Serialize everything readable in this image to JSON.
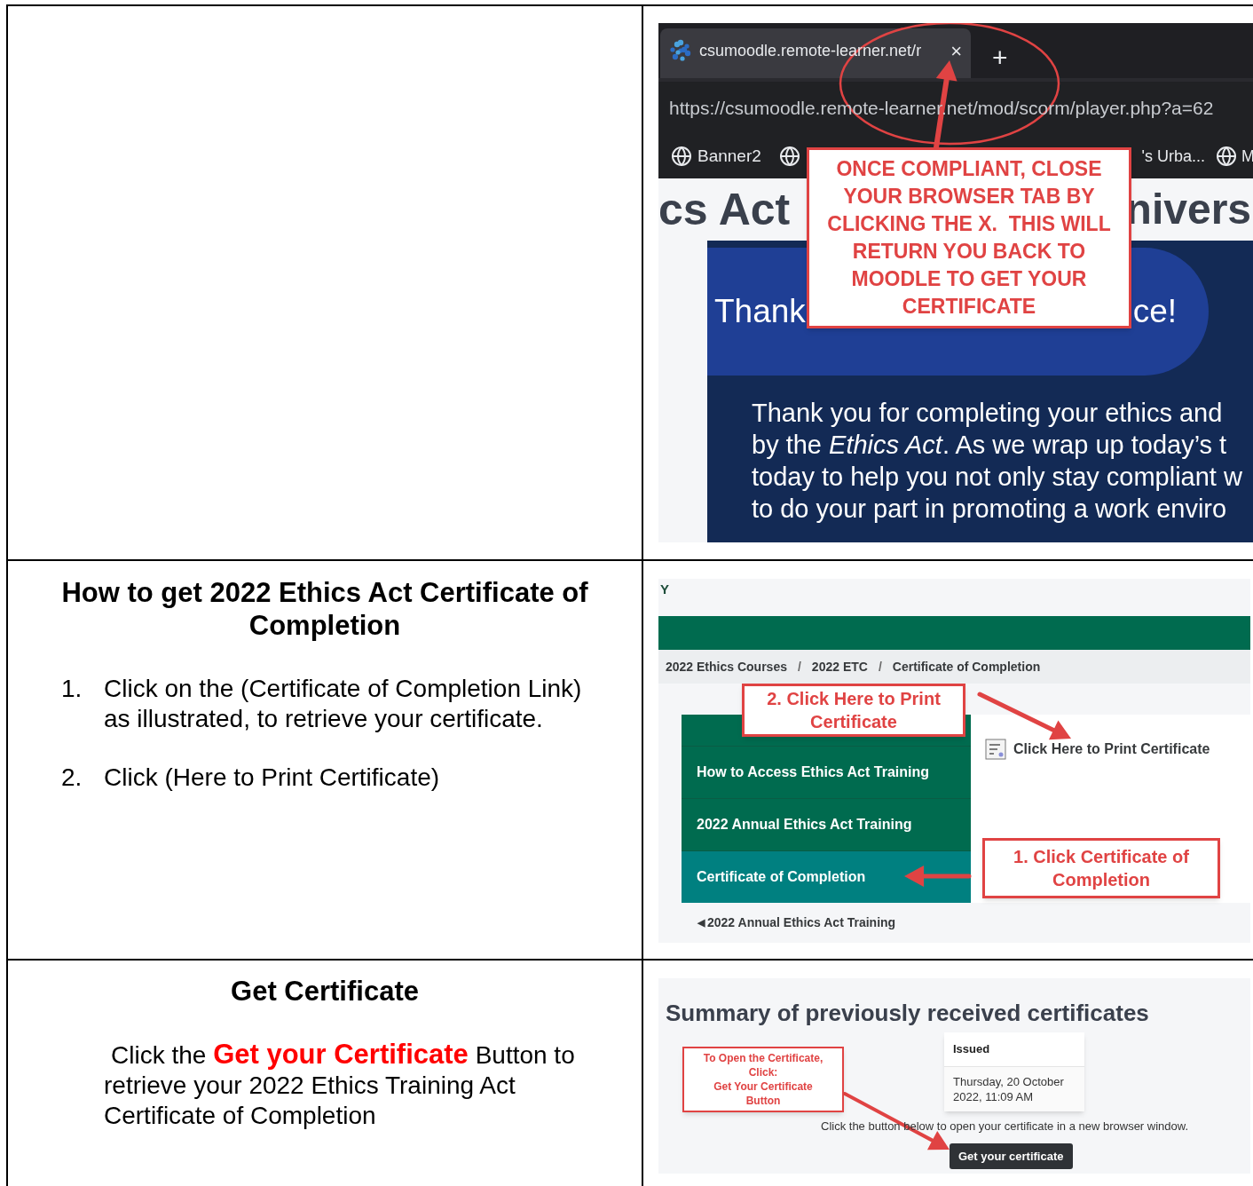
{
  "row_1": {
    "screenshot": {
      "tab_title": "csumoodle.remote-learner.net/r",
      "tab_close": "×",
      "new_tab": "+",
      "url": "https://csumoodle.remote-learner.net/mod/scorm/player.php?a=62",
      "bookmarks_left": [
        {
          "kind": "labeled",
          "label": "Banner2"
        },
        {
          "kind": "icon_only"
        }
      ],
      "bookmarks_right": [
        {
          "label": "'s Urba..."
        },
        {
          "label": "M"
        }
      ],
      "heading_left": "cs Act",
      "heading_right": "nivers",
      "banner_left": "Thank",
      "banner_right": "ce!",
      "body_lines": [
        "Thank you for completing your ethics and",
        "by the *Ethics Act*. As we wrap up today’s t",
        "today to help you not only stay compliant w",
        "to do your part in promoting a work enviro"
      ],
      "callout": "ONCE COMPLIANT, CLOSE YOUR BROWSER TAB BY CLICKING THE X.  THIS WILL RETURN YOU BACK TO MOODLE TO GET YOUR CERTIFICATE"
    }
  },
  "row_2": {
    "instructions": {
      "title": "How to get 2022 Ethics Act Certificate of Completion",
      "steps": [
        {
          "number": "1.",
          "text": "Click on the (Certificate of Completion Link) as illustrated, to retrieve your certificate."
        },
        {
          "number": "2.",
          "text": "Click (Here to Print Certificate)"
        }
      ]
    },
    "screenshot": {
      "logo_letter": "Y",
      "breadcrumbs": [
        {
          "label": "2022 Ethics Courses"
        },
        {
          "separator": "/",
          "label": "2022 ETC"
        },
        {
          "separator": "/",
          "label": "Certificate of Completion"
        }
      ],
      "nav_items": [
        {
          "label": "How to Access Ethics Act Training",
          "selected": false
        },
        {
          "label": "2022 Annual Ethics Act Training",
          "selected": false
        },
        {
          "label": "Certificate of Completion",
          "selected": true
        }
      ],
      "print_link": "Click Here to Print Certificate",
      "back_arrow": "◀",
      "back_link": "2022 Annual Ethics Act Training",
      "callout_print": "2. Click Here to Print Certificate",
      "callout_certificate": "1. Click Certificate of Completion"
    }
  },
  "row_3": {
    "instructions": {
      "title": "Get Certificate",
      "text": "Click the **Get your Certificate** Button to retrieve your 2022 Ethics Training Act Certificate of Completion"
    },
    "screenshot": {
      "heading": "Summary of previously received certificates",
      "callout_lines": [
        "To Open the Certificate,",
        "Click:",
        "Get Your Certificate",
        "Button"
      ],
      "issued_header": "Issued",
      "issued_value": "Thursday, 20 October 2022, 11:09 AM",
      "note": "Click the button below to open your certificate in a new browser window.",
      "button": "Get your certificate"
    }
  }
}
